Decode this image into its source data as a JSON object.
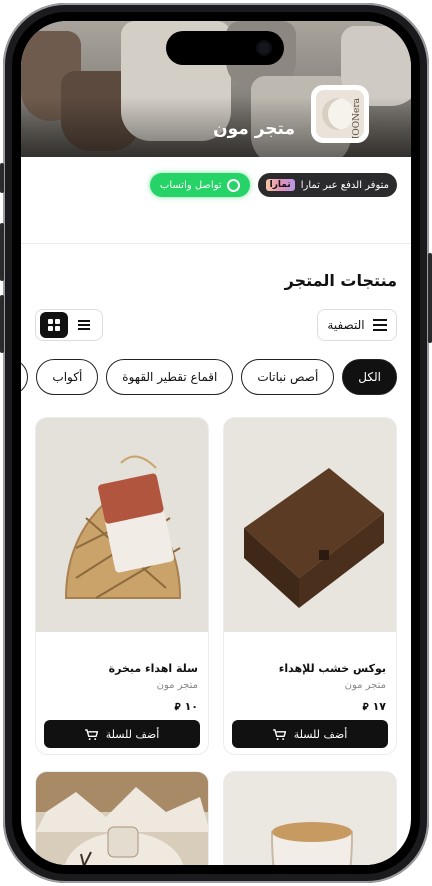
{
  "store": {
    "name": "متجر مون",
    "logo_text": "MOONera"
  },
  "badges": {
    "payment_label": "متوفر الدفع عبر تمارا",
    "payment_brand": "تمارا",
    "whatsapp_label": "تواصل واتساب"
  },
  "products_section": {
    "title": "منتجات المتجر",
    "filter_label": "التصفية",
    "grid_view_icon": "grid-icon",
    "list_view_icon": "list-icon"
  },
  "categories": [
    {
      "label": "الكل",
      "active": true
    },
    {
      "label": "أصص نباتات",
      "active": false
    },
    {
      "label": "اقماع تقطير القهوة",
      "active": false
    },
    {
      "label": "أكواب",
      "active": false
    },
    {
      "label": "أك",
      "active": false
    }
  ],
  "products": [
    {
      "name": "بوكس خشب للإهداء",
      "store": "متجر مون",
      "price": "١٧",
      "add_label": "أضف للسلة"
    },
    {
      "name": "سلة اهداء مبخرة",
      "store": "متجر مون",
      "price": "١٠",
      "add_label": "أضف للسلة"
    }
  ],
  "colors": {
    "accent": "#111111",
    "whatsapp": "#25d366",
    "payment_badge": "#2b2b2d"
  }
}
